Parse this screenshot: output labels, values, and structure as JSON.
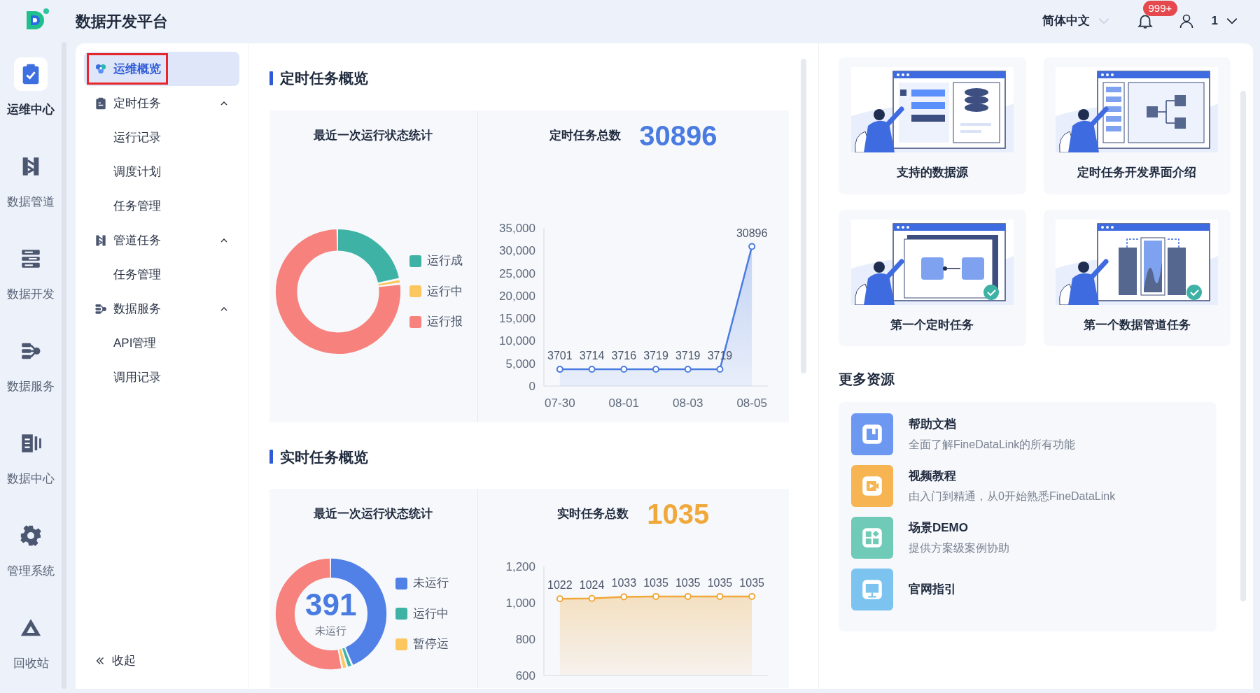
{
  "header": {
    "title": "数据开发平台",
    "language": "简体中文",
    "notification_count": "999+",
    "user": "1"
  },
  "rail": {
    "items": [
      {
        "label": "运维中心",
        "selected": true
      },
      {
        "label": "数据管道",
        "selected": false
      },
      {
        "label": "数据开发",
        "selected": false
      },
      {
        "label": "数据服务",
        "selected": false
      },
      {
        "label": "数据中心",
        "selected": false
      },
      {
        "label": "管理系统",
        "selected": false
      },
      {
        "label": "回收站",
        "selected": false
      }
    ]
  },
  "nav": {
    "items": [
      {
        "kind": "link",
        "label": "运维概览",
        "selected": true,
        "highlighted": true
      },
      {
        "kind": "group",
        "label": "定时任务",
        "selected": false,
        "highlighted": false,
        "expanded": true,
        "children": [
          {
            "label": "运行记录",
            "selected": false
          },
          {
            "label": "调度计划",
            "selected": false
          },
          {
            "label": "任务管理",
            "selected": false
          }
        ]
      },
      {
        "kind": "group",
        "label": "管道任务",
        "selected": false,
        "highlighted": false,
        "expanded": true,
        "children": [
          {
            "label": "任务管理",
            "selected": false
          }
        ]
      },
      {
        "kind": "group",
        "label": "数据服务",
        "selected": false,
        "highlighted": false,
        "expanded": true,
        "children": [
          {
            "label": "API管理",
            "selected": false
          },
          {
            "label": "调用记录",
            "selected": false
          }
        ]
      }
    ],
    "collapse_label": "收起"
  },
  "sections": [
    {
      "title": "定时任务概览",
      "status_title": "最近一次运行状态统计",
      "legend": [
        {
          "label": "运行成",
          "color": "#3fb2a6"
        },
        {
          "label": "运行中",
          "color": "#fcc75e"
        },
        {
          "label": "运行报",
          "color": "#f7827d"
        }
      ],
      "total_label": "定时任务总数",
      "total_value": "30896",
      "chart_data": {
        "type": "area",
        "categories": [
          "07-30",
          null,
          "08-01",
          null,
          "08-03",
          null,
          "08-05"
        ],
        "series": [
          {
            "color": "#4a7be0",
            "values": [
              3701,
              3714,
              3716,
              3719,
              3719,
              3719,
              30896
            ]
          }
        ],
        "ylim": [
          0,
          35000
        ],
        "yticks": [
          {
            "value": 0,
            "label": "0"
          },
          {
            "value": 5000,
            "label": "5,000"
          },
          {
            "value": 10000,
            "label": "10,000"
          },
          {
            "value": 15000,
            "label": "15,000"
          },
          {
            "value": 20000,
            "label": "20,000"
          },
          {
            "value": 25000,
            "label": "25,000"
          },
          {
            "value": 30000,
            "label": "30,000"
          },
          {
            "value": 35000,
            "label": "35,000"
          }
        ],
        "data_labels": true
      }
    },
    {
      "title": "实时任务概览",
      "status_title": "最近一次运行状态统计",
      "center_value": "391",
      "center_label": "未运行",
      "legend": [
        {
          "label": "未运行",
          "color": "#5180e6"
        },
        {
          "label": "运行中",
          "color": "#3fb2a6"
        },
        {
          "label": "暂停运",
          "color": "#fcc75e"
        }
      ],
      "total_label": "实时任务总数",
      "total_value": "1035",
      "chart_data": {
        "type": "area",
        "categories": [
          null,
          null,
          null,
          null,
          null,
          null,
          null
        ],
        "series": [
          {
            "color": "#f0a83a",
            "values": [
              1022,
              1024,
              1033,
              1035,
              1035,
              1035,
              1035
            ]
          }
        ],
        "ylim": [
          600,
          1200
        ],
        "yticks": [
          {
            "value": 600,
            "label": "600"
          },
          {
            "value": 800,
            "label": "800"
          },
          {
            "value": 1000,
            "label": "1,000"
          },
          {
            "value": 1200,
            "label": "1,200"
          }
        ],
        "data_labels": true
      }
    }
  ],
  "tutorials": [
    {
      "title": "支持的数据源"
    },
    {
      "title": "定时任务开发界面介绍"
    },
    {
      "title": "第一个定时任务"
    },
    {
      "title": "第一个数据管道任务"
    }
  ],
  "resources": {
    "title": "更多资源",
    "items": [
      {
        "title": "帮助文档",
        "description": "全面了解FineDataLink的所有功能",
        "color": "#6d98f2"
      },
      {
        "title": "视频教程",
        "description": "由入门到精通，从0开始熟悉FineDataLink",
        "color": "#f6b552"
      },
      {
        "title": "场景DEMO",
        "description": "提供方案级案例协助",
        "color": "#6fcab8"
      },
      {
        "title": "官网指引",
        "color": "#7cc4ef"
      }
    ]
  }
}
